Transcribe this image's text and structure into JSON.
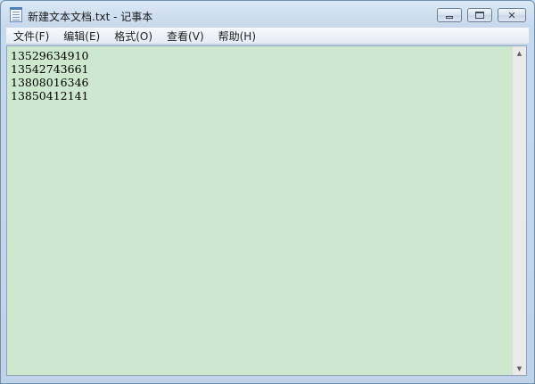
{
  "window": {
    "title": "新建文本文档.txt - 记事本",
    "icon": "notepad-icon"
  },
  "titlebar_buttons": {
    "minimize": "minimize-icon",
    "maximize": "maximize-icon",
    "close": "close-icon"
  },
  "menu": {
    "items": [
      {
        "label": "文件(F)"
      },
      {
        "label": "编辑(E)"
      },
      {
        "label": "格式(O)"
      },
      {
        "label": "查看(V)"
      },
      {
        "label": "帮助(H)"
      }
    ]
  },
  "editor": {
    "lines": [
      "13529634910",
      "13542743661",
      "13808016346",
      "13850412141"
    ],
    "background": "#cce8cf"
  },
  "scrollbar": {
    "up": "▲",
    "down": "▼"
  }
}
